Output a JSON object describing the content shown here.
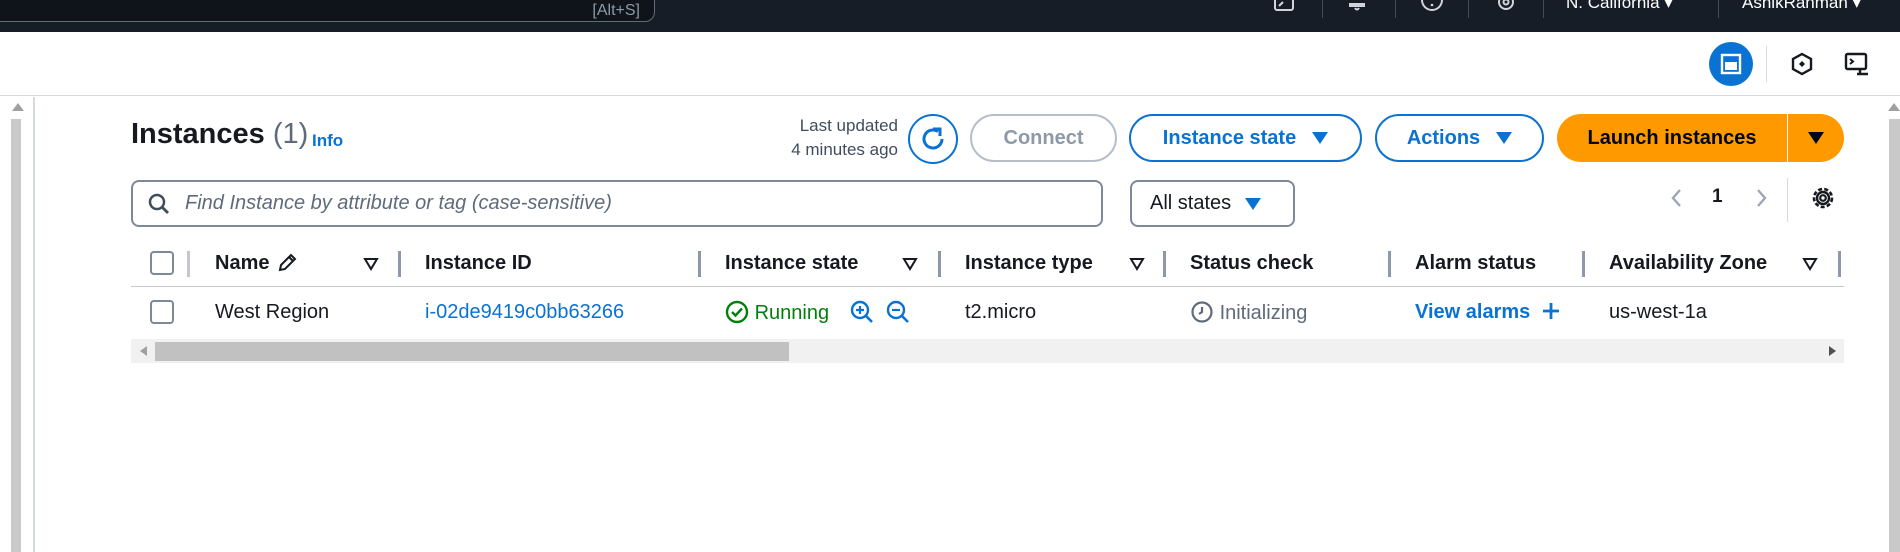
{
  "topnav": {
    "search_shortcut": "[Alt+S]",
    "region": "N. California",
    "user": "AshikRahman"
  },
  "header": {
    "title": "Instances",
    "count": "(1)",
    "info": "Info",
    "last_updated_line1": "Last updated",
    "last_updated_line2": "4 minutes ago"
  },
  "actions": {
    "connect": "Connect",
    "instance_state": "Instance state",
    "actions": "Actions",
    "launch": "Launch instances"
  },
  "filter": {
    "placeholder": "Find Instance by attribute or tag (case-sensitive)",
    "value": "",
    "state_select": "All states"
  },
  "pagination": {
    "current_page": "1"
  },
  "table": {
    "columns": [
      "Name",
      "Instance ID",
      "Instance state",
      "Instance type",
      "Status check",
      "Alarm status",
      "Availability Zone"
    ],
    "rows": [
      {
        "name": "West Region",
        "instance_id": "i-02de9419c0bb63266",
        "state": "Running",
        "type": "t2.micro",
        "status_check": "Initializing",
        "alarm": "View alarms",
        "zone": "us-west-1a"
      }
    ]
  },
  "colors": {
    "accent": "#0972d3",
    "launch": "#ff9900",
    "running": "#037f0c",
    "nav_bg": "#161d26"
  },
  "icons": [
    "search-icon",
    "refresh-icon",
    "pencil-icon",
    "check-circle-icon",
    "zoom-in-icon",
    "zoom-out-icon",
    "clock-icon",
    "plus-icon",
    "gear-icon",
    "bell-icon",
    "help-icon",
    "cloudshell-icon"
  ]
}
